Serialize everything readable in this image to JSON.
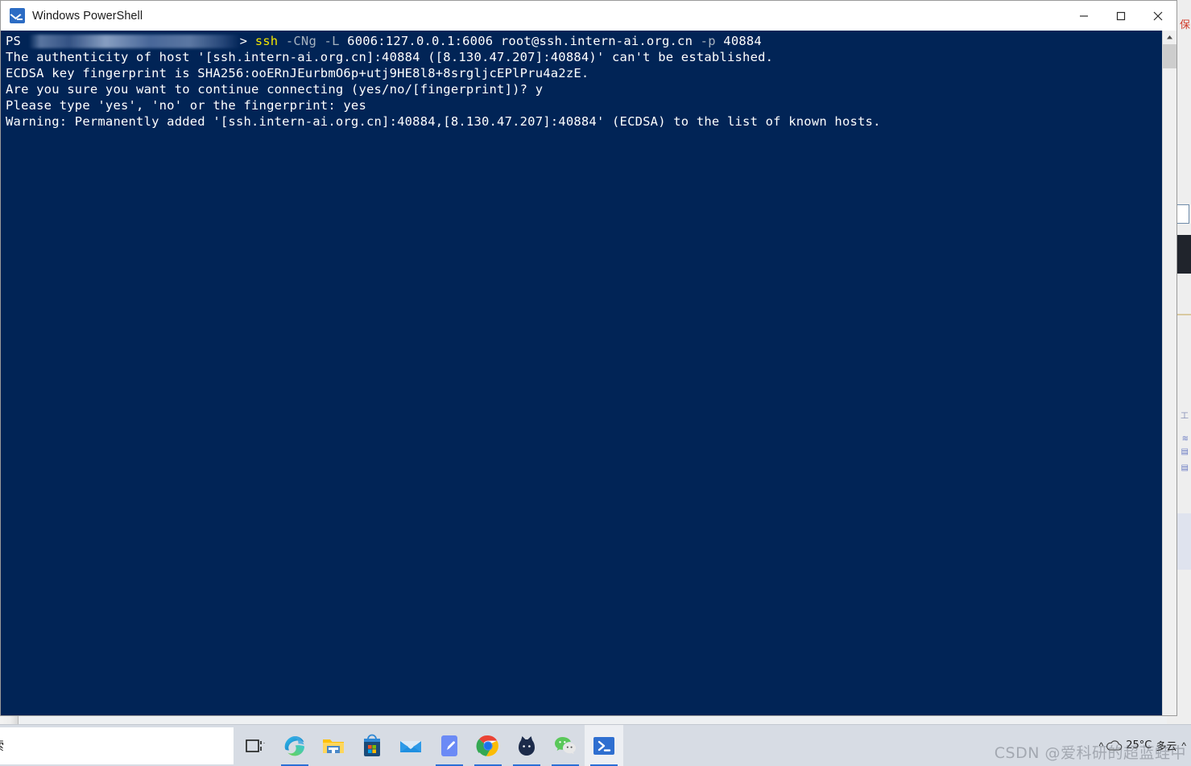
{
  "window": {
    "title": "Windows PowerShell",
    "icon": "powershell-icon",
    "controls": {
      "minimize": "minimize-button",
      "maximize": "maximize-button",
      "close": "close-button"
    }
  },
  "console": {
    "background_color": "#012456",
    "foreground_color": "#ffffff",
    "command_color": "#f2e600",
    "parameter_color": "#a6b2bf",
    "prompt_prefix": "PS ",
    "prompt_path_redacted": true,
    "prompt_suffix": ">",
    "command": {
      "executable": "ssh",
      "flag1": "-CNg",
      "flag2": "-L",
      "forward": "6006:127.0.0.1:6006",
      "target": "root@ssh.intern-ai.org.cn",
      "flag3": "-p",
      "port": "40884"
    },
    "output_lines": [
      "The authenticity of host '[ssh.intern-ai.org.cn]:40884 ([8.130.47.207]:40884)' can't be established.",
      "ECDSA key fingerprint is SHA256:ooERnJEurbmO6p+utj9HE8l8+8srgljcEPlPru4a2zE.",
      "Are you sure you want to continue connecting (yes/no/[fingerprint])? y",
      "Please type 'yes', 'no' or the fingerprint: yes",
      "Warning: Permanently added '[ssh.intern-ai.org.cn]:40884,[8.130.47.207]:40884' (ECDSA) to the list of known hosts."
    ]
  },
  "scrollbar": {
    "up_arrow": "scroll-up-icon",
    "position": "top"
  },
  "taskbar": {
    "search_placeholder": "索",
    "items": [
      {
        "name": "task-view",
        "label": "Task View",
        "running": false,
        "active": false
      },
      {
        "name": "microsoft-edge",
        "label": "Microsoft Edge",
        "running": true,
        "active": false
      },
      {
        "name": "file-explorer",
        "label": "File Explorer",
        "running": false,
        "active": false
      },
      {
        "name": "microsoft-store",
        "label": "Microsoft Store",
        "running": false,
        "active": false
      },
      {
        "name": "mail",
        "label": "Mail",
        "running": false,
        "active": false
      },
      {
        "name": "onenote",
        "label": "OneNote",
        "running": true,
        "active": false
      },
      {
        "name": "google-chrome",
        "label": "Google Chrome",
        "running": true,
        "active": false
      },
      {
        "name": "cat-app",
        "label": "Cat App",
        "running": true,
        "active": false
      },
      {
        "name": "wechat",
        "label": "WeChat",
        "running": true,
        "active": false
      },
      {
        "name": "windows-powershell",
        "label": "Windows PowerShell",
        "running": true,
        "active": true
      }
    ],
    "tray": {
      "weather_temperature": "25°C",
      "weather_condition": "多云",
      "chevron": "^"
    },
    "watermark": "CSDN @爱科研的超蓝蛙中"
  },
  "background": {
    "right_red_text": "保"
  }
}
